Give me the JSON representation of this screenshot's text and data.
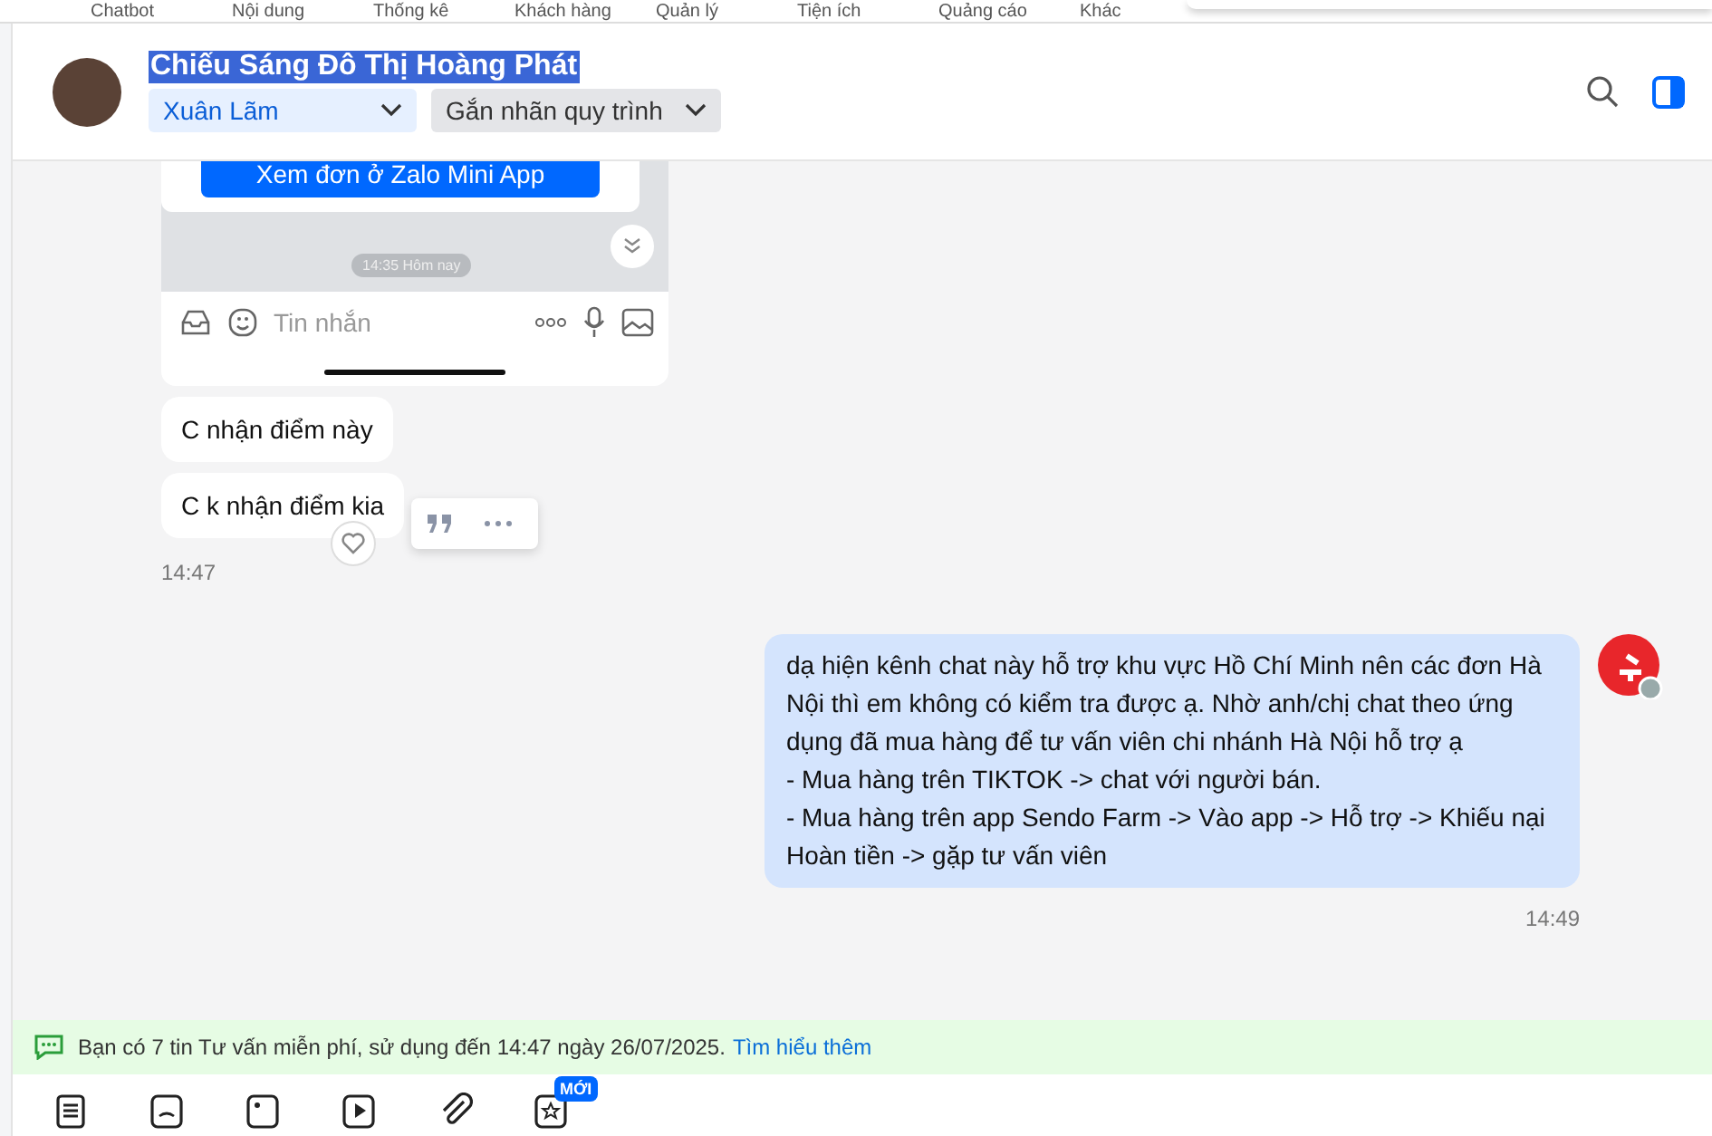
{
  "top_nav": [
    {
      "label": "Chatbot"
    },
    {
      "label": "Nội dung"
    },
    {
      "label": "Thống kê"
    },
    {
      "label": "Khách hàng"
    },
    {
      "label": "Quản lý"
    },
    {
      "label": "Tiện ích"
    },
    {
      "label": "Quảng cáo"
    },
    {
      "label": "Khác"
    }
  ],
  "header": {
    "title": "Chiếu Sáng Đô Thị Hoàng Phát",
    "title_selected": true,
    "assignee": "Xuân Lãm",
    "tag_dropdown": "Gắn nhãn quy trình"
  },
  "screenshot": {
    "button": "Xem đơn ở Zalo Mini App",
    "timestamp": "14:35 Hôm nay",
    "input_placeholder": "Tin nhắn"
  },
  "incoming": [
    {
      "text": "C nhận điểm này"
    },
    {
      "text": "C k nhận điểm kia"
    }
  ],
  "incoming_time": "14:47",
  "outgoing": {
    "lines": [
      "dạ hiện kênh chat này hỗ trợ khu vực Hồ Chí Minh nên các đơn Hà Nội thì em không có kiểm tra được ạ. Nhờ anh/chị chat theo ứng dụng đã mua hàng để tư vấn viên chi nhánh Hà Nội hỗ trợ ạ",
      "- Mua hàng trên TIKTOK -> chat với người bán.",
      "- Mua hàng trên app Sendo Farm -> Vào app -> Hỗ trợ -> Khiếu nại Hoàn tiền -> gặp tư vấn viên"
    ],
    "time": "14:49"
  },
  "notice": {
    "text": "Bạn có 7 tin Tư vấn miễn phí, sử dụng đến 14:47 ngày 26/07/2025.",
    "link": "Tìm hiểu thêm"
  },
  "toolbar": [
    {
      "kind": "list"
    },
    {
      "kind": "sticker"
    },
    {
      "kind": "image"
    },
    {
      "kind": "video"
    },
    {
      "kind": "attach"
    },
    {
      "kind": "star",
      "badge": "MỚI"
    }
  ]
}
